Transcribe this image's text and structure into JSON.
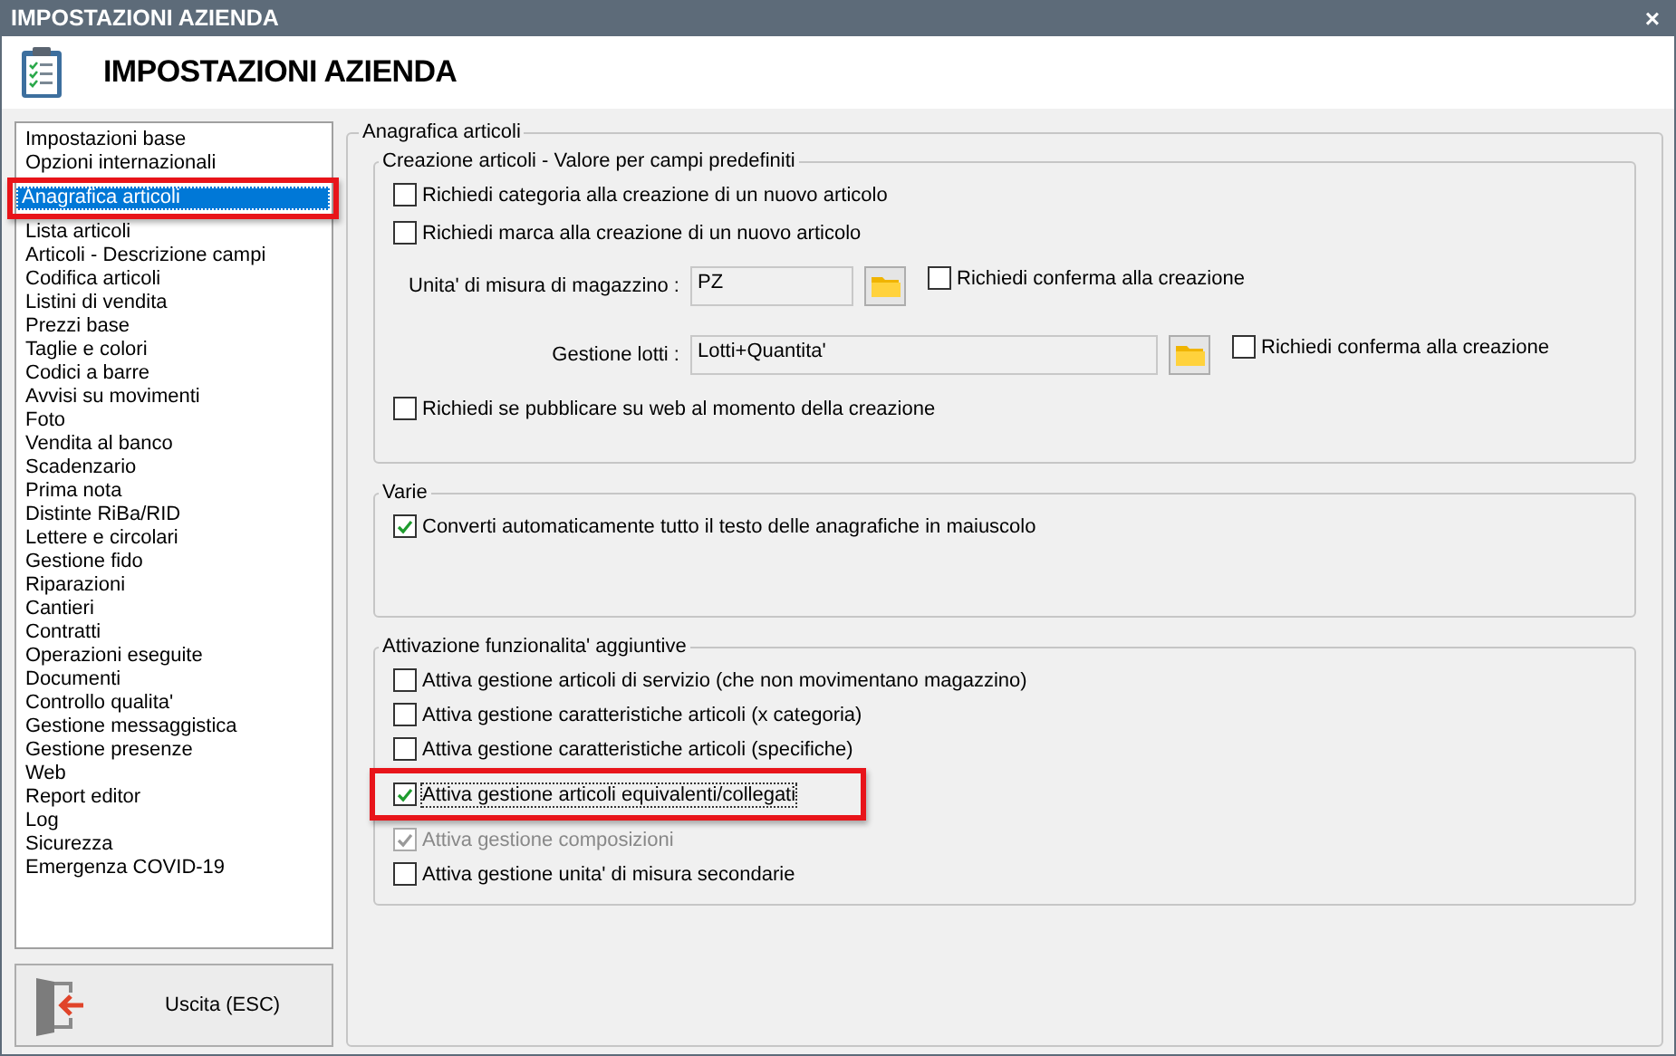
{
  "window": {
    "title": "IMPOSTAZIONI AZIENDA",
    "close": "×"
  },
  "header": {
    "title": "IMPOSTAZIONI AZIENDA"
  },
  "sidebar": {
    "items": [
      {
        "label": "Impostazioni base",
        "selected": false,
        "highlighted": false
      },
      {
        "label": "Opzioni internazionali",
        "selected": false,
        "highlighted": false
      },
      {
        "label": "Anagrafica articoli",
        "selected": true,
        "highlighted": true
      },
      {
        "label": "Lista articoli",
        "selected": false,
        "highlighted": false
      },
      {
        "label": "Articoli - Descrizione campi",
        "selected": false,
        "highlighted": false
      },
      {
        "label": "Codifica articoli",
        "selected": false,
        "highlighted": false
      },
      {
        "label": "Listini di vendita",
        "selected": false,
        "highlighted": false
      },
      {
        "label": "Prezzi base",
        "selected": false,
        "highlighted": false
      },
      {
        "label": "Taglie e colori",
        "selected": false,
        "highlighted": false
      },
      {
        "label": "Codici a barre",
        "selected": false,
        "highlighted": false
      },
      {
        "label": "Avvisi su movimenti",
        "selected": false,
        "highlighted": false
      },
      {
        "label": "Foto",
        "selected": false,
        "highlighted": false
      },
      {
        "label": "Vendita al banco",
        "selected": false,
        "highlighted": false
      },
      {
        "label": "Scadenzario",
        "selected": false,
        "highlighted": false
      },
      {
        "label": "Prima nota",
        "selected": false,
        "highlighted": false
      },
      {
        "label": "Distinte RiBa/RID",
        "selected": false,
        "highlighted": false
      },
      {
        "label": "Lettere e circolari",
        "selected": false,
        "highlighted": false
      },
      {
        "label": "Gestione fido",
        "selected": false,
        "highlighted": false
      },
      {
        "label": "Riparazioni",
        "selected": false,
        "highlighted": false
      },
      {
        "label": "Cantieri",
        "selected": false,
        "highlighted": false
      },
      {
        "label": "Contratti",
        "selected": false,
        "highlighted": false
      },
      {
        "label": "Operazioni eseguite",
        "selected": false,
        "highlighted": false
      },
      {
        "label": "Documenti",
        "selected": false,
        "highlighted": false
      },
      {
        "label": "Controllo qualita'",
        "selected": false,
        "highlighted": false
      },
      {
        "label": "Gestione messaggistica",
        "selected": false,
        "highlighted": false
      },
      {
        "label": "Gestione presenze",
        "selected": false,
        "highlighted": false
      },
      {
        "label": "Web",
        "selected": false,
        "highlighted": false
      },
      {
        "label": "Report editor",
        "selected": false,
        "highlighted": false
      },
      {
        "label": "Log",
        "selected": false,
        "highlighted": false
      },
      {
        "label": "Sicurezza",
        "selected": false,
        "highlighted": false
      },
      {
        "label": "Emergenza COVID-19",
        "selected": false,
        "highlighted": false
      }
    ]
  },
  "exit_button": {
    "label": "Uscita (ESC)"
  },
  "panel": {
    "title": "Anagrafica articoli",
    "groups": [
      {
        "title": "Creazione articoli - Valore per campi predefiniti",
        "rows": [
          {
            "kind": "checkbox",
            "label": "Richiedi categoria alla creazione di un nuovo articolo",
            "checked": false,
            "disabled": false,
            "highlighted": false
          },
          {
            "kind": "checkbox",
            "label": "Richiedi marca alla creazione di un nuovo articolo",
            "checked": false,
            "disabled": false,
            "highlighted": false
          },
          {
            "kind": "field",
            "label": "Unita' di misura di magazzino :",
            "value": "PZ",
            "confirm": {
              "label": "Richiedi conferma alla creazione",
              "checked": false
            }
          },
          {
            "kind": "field",
            "label": "Gestione lotti :",
            "value": "Lotti+Quantita'",
            "confirm": {
              "label": "Richiedi conferma alla creazione",
              "checked": false
            }
          },
          {
            "kind": "checkbox",
            "label": "Richiedi se pubblicare su web al momento della creazione",
            "checked": false,
            "disabled": false,
            "highlighted": false
          }
        ]
      },
      {
        "title": "Varie",
        "rows": [
          {
            "kind": "checkbox",
            "label": "Converti automaticamente tutto il testo delle anagrafiche in maiuscolo",
            "checked": true,
            "disabled": false,
            "highlighted": false
          }
        ]
      },
      {
        "title": "Attivazione funzionalita' aggiuntive",
        "rows": [
          {
            "kind": "checkbox",
            "label": "Attiva gestione articoli di servizio (che non movimentano magazzino)",
            "checked": false,
            "disabled": false,
            "highlighted": false
          },
          {
            "kind": "checkbox",
            "label": "Attiva gestione caratteristiche articoli (x categoria)",
            "checked": false,
            "disabled": false,
            "highlighted": false
          },
          {
            "kind": "checkbox",
            "label": "Attiva gestione caratteristiche articoli (specifiche)",
            "checked": false,
            "disabled": false,
            "highlighted": false
          },
          {
            "kind": "checkbox",
            "label": "Attiva gestione articoli equivalenti/collegati",
            "checked": true,
            "disabled": false,
            "highlighted": true
          },
          {
            "kind": "checkbox",
            "label": "Attiva gestione composizioni",
            "checked": true,
            "disabled": true,
            "highlighted": false
          },
          {
            "kind": "checkbox",
            "label": "Attiva gestione unita' di misura secondarie",
            "checked": false,
            "disabled": false,
            "highlighted": false
          }
        ]
      }
    ]
  }
}
